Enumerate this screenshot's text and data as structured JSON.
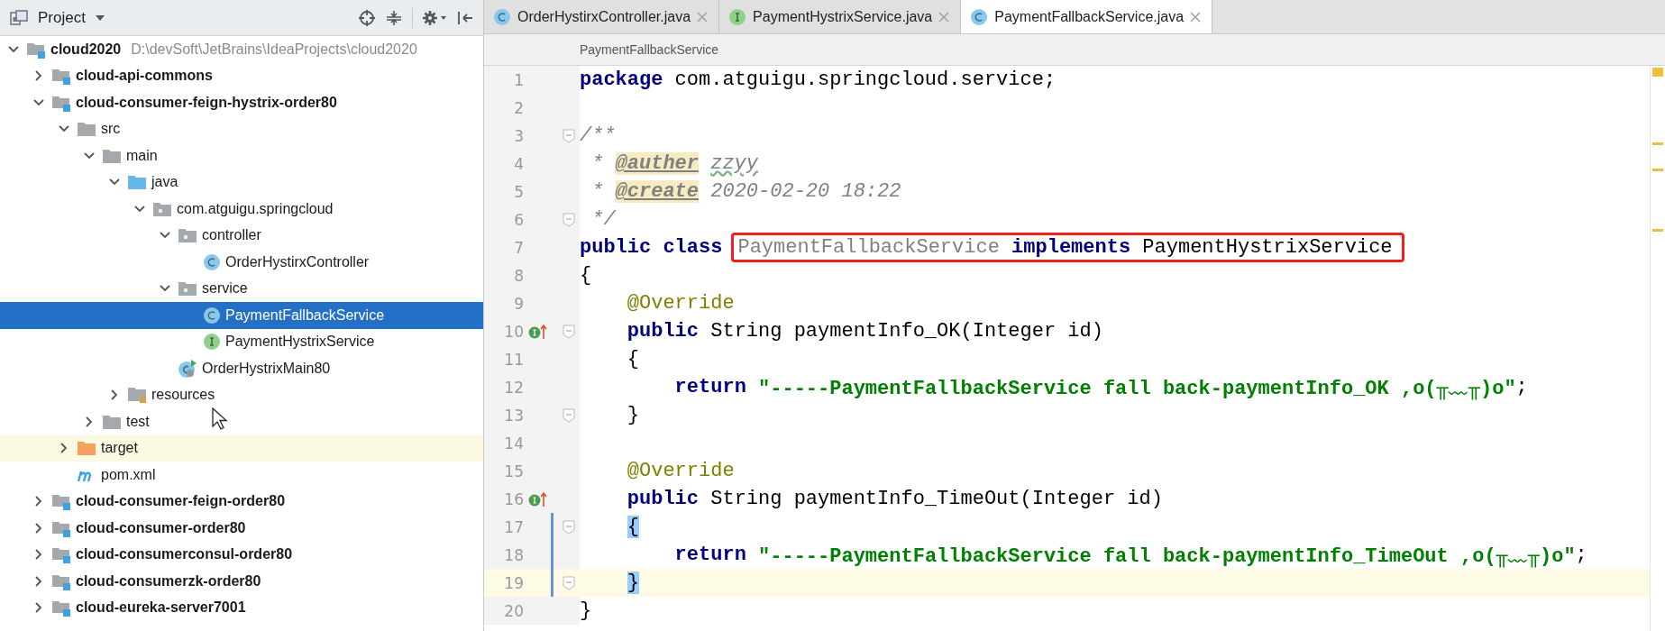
{
  "project_panel": {
    "title": "Project"
  },
  "tree": [
    {
      "label": "cloud2020",
      "detail": "D:\\devSoft\\JetBrains\\IdeaProjects\\cloud2020",
      "kind": "module",
      "expanded": true,
      "selected": false,
      "children": [
        {
          "label": "cloud-api-commons",
          "kind": "module",
          "expanded": false,
          "selected": false
        },
        {
          "label": "cloud-consumer-feign-hystrix-order80",
          "kind": "module",
          "expanded": true,
          "selected": false,
          "children": [
            {
              "label": "src",
              "kind": "folder",
              "expanded": true,
              "selected": false,
              "children": [
                {
                  "label": "main",
                  "kind": "folder",
                  "expanded": true,
                  "selected": false,
                  "children": [
                    {
                      "label": "java",
                      "kind": "source",
                      "expanded": true,
                      "selected": false,
                      "children": [
                        {
                          "label": "com.atguigu.springcloud",
                          "kind": "package",
                          "expanded": true,
                          "selected": false,
                          "children": [
                            {
                              "label": "controller",
                              "kind": "package",
                              "expanded": true,
                              "selected": false,
                              "children": [
                                {
                                  "label": "OrderHystirxController",
                                  "kind": "class",
                                  "selected": false
                                }
                              ]
                            },
                            {
                              "label": "service",
                              "kind": "package",
                              "expanded": true,
                              "selected": false,
                              "children": [
                                {
                                  "label": "PaymentFallbackService",
                                  "kind": "class",
                                  "selected": true
                                },
                                {
                                  "label": "PaymentHystrixService",
                                  "kind": "interface",
                                  "selected": false
                                }
                              ]
                            },
                            {
                              "label": "OrderHystrixMain80",
                              "kind": "app",
                              "selected": false
                            }
                          ]
                        }
                      ]
                    },
                    {
                      "label": "resources",
                      "kind": "resources",
                      "expanded": false,
                      "selected": false
                    }
                  ]
                },
                {
                  "label": "test",
                  "kind": "folder",
                  "expanded": false,
                  "selected": false
                }
              ]
            },
            {
              "label": "target",
              "kind": "excluded",
              "expanded": false,
              "selected": false
            },
            {
              "label": "pom.xml",
              "kind": "maven",
              "selected": false
            }
          ]
        },
        {
          "label": "cloud-consumer-feign-order80",
          "kind": "module",
          "expanded": false,
          "selected": false
        },
        {
          "label": "cloud-consumer-order80",
          "kind": "module",
          "expanded": false,
          "selected": false
        },
        {
          "label": "cloud-consumerconsul-order80",
          "kind": "module",
          "expanded": false,
          "selected": false
        },
        {
          "label": "cloud-consumerzk-order80",
          "kind": "module",
          "expanded": false,
          "selected": false
        },
        {
          "label": "cloud-eureka-server7001",
          "kind": "module",
          "expanded": false,
          "selected": false
        }
      ]
    }
  ],
  "tabs": [
    {
      "label": "OrderHystirxController.java",
      "kind": "class",
      "selected": false
    },
    {
      "label": "PaymentHystrixService.java",
      "kind": "interface",
      "selected": false
    },
    {
      "label": "PaymentFallbackService.java",
      "kind": "class",
      "selected": true
    }
  ],
  "breadcrumb": "PaymentFallbackService",
  "code": [
    {
      "num": "1",
      "fold": false,
      "marker": false,
      "current": false,
      "changed": false,
      "tokens": [
        {
          "text": "package",
          "kind": "keyword"
        },
        {
          "text": " com.atguigu.springcloud.service;",
          "kind": "plain"
        }
      ]
    },
    {
      "num": "2",
      "fold": false,
      "marker": false,
      "current": false,
      "changed": false
    },
    {
      "num": "3",
      "fold": true,
      "marker": false,
      "current": false,
      "changed": false,
      "tokens": [
        {
          "text": "/**",
          "kind": "comment"
        }
      ]
    },
    {
      "num": "4",
      "fold": false,
      "marker": false,
      "current": false,
      "changed": false,
      "tokens": [
        {
          "text": " * ",
          "kind": "comment"
        },
        {
          "text": "@auther",
          "kind": "doctag"
        },
        {
          "text": "zzyy",
          "kind": "typo"
        }
      ]
    },
    {
      "num": "5",
      "fold": false,
      "marker": false,
      "current": false,
      "changed": false,
      "tokens": [
        {
          "text": " * ",
          "kind": "comment"
        },
        {
          "text": "@create",
          "kind": "doctag"
        },
        {
          "text": " 2020-02-20 18:22",
          "kind": "comment"
        }
      ]
    },
    {
      "num": "6",
      "fold": true,
      "marker": false,
      "current": false,
      "changed": false,
      "tokens": [
        {
          "text": " */",
          "kind": "comment"
        }
      ]
    },
    {
      "num": "7",
      "fold": false,
      "marker": false,
      "current": false,
      "changed": false,
      "tokens": [
        {
          "text": "public class",
          "kind": "keyword"
        }
      ],
      "boxed_tokens": [
        {
          "text": "PaymentFallbackService",
          "kind": "unused"
        },
        {
          "text": " implements",
          "kind": "keyword"
        },
        {
          "text": " PaymentHystrixService",
          "kind": "plain"
        }
      ]
    },
    {
      "num": "8",
      "fold": false,
      "marker": false,
      "current": false,
      "changed": false,
      "tokens": [
        {
          "text": "{",
          "kind": "plain"
        }
      ]
    },
    {
      "num": "9",
      "fold": false,
      "marker": false,
      "current": false,
      "changed": false,
      "tokens": [
        {
          "text": "    @Override",
          "kind": "annotation"
        }
      ]
    },
    {
      "num": "10",
      "fold": true,
      "marker": true,
      "current": false,
      "changed": false,
      "tokens": [
        {
          "text": "    public",
          "kind": "keyword"
        },
        {
          "text": " String paymentInfo_OK(Integer id)",
          "kind": "plain"
        }
      ]
    },
    {
      "num": "11",
      "fold": false,
      "marker": false,
      "current": false,
      "changed": false,
      "tokens": [
        {
          "text": "    {",
          "kind": "plain"
        }
      ]
    },
    {
      "num": "12",
      "fold": false,
      "marker": false,
      "current": false,
      "changed": false,
      "tokens": [
        {
          "text": "        return ",
          "kind": "keyword"
        },
        {
          "text": "\"-----PaymentFallbackService fall back-paymentInfo_OK ,o(╥﹏╥)o\"",
          "kind": "string"
        },
        {
          "text": ";",
          "kind": "plain"
        }
      ]
    },
    {
      "num": "13",
      "fold": true,
      "marker": false,
      "current": false,
      "changed": false,
      "tokens": [
        {
          "text": "    }",
          "kind": "plain"
        }
      ]
    },
    {
      "num": "14",
      "fold": false,
      "marker": false,
      "current": false,
      "changed": false
    },
    {
      "num": "15",
      "fold": false,
      "marker": false,
      "current": false,
      "changed": false,
      "tokens": [
        {
          "text": "    @Override",
          "kind": "annotation"
        }
      ]
    },
    {
      "num": "16",
      "fold": false,
      "marker": true,
      "current": false,
      "changed": false,
      "tokens": [
        {
          "text": "    public",
          "kind": "keyword"
        },
        {
          "text": " String paymentInfo_TimeOut(Integer id)",
          "kind": "plain"
        }
      ]
    },
    {
      "num": "17",
      "fold": true,
      "marker": false,
      "current": false,
      "changed": true,
      "tokens": [
        {
          "text": "{",
          "kind": "indented-brace"
        }
      ]
    },
    {
      "num": "18",
      "fold": false,
      "marker": false,
      "current": false,
      "changed": true,
      "tokens": [
        {
          "text": "        return ",
          "kind": "keyword"
        },
        {
          "text": "\"-----PaymentFallbackService fall back-paymentInfo_TimeOut ,o(╥﹏╥)o\"",
          "kind": "string"
        },
        {
          "text": ";",
          "kind": "plain"
        }
      ]
    },
    {
      "num": "19",
      "fold": true,
      "marker": false,
      "current": true,
      "changed": true,
      "tokens": [
        {
          "text": "}",
          "kind": "indented-brace"
        }
      ]
    },
    {
      "num": "20",
      "fold": false,
      "marker": false,
      "current": false,
      "changed": false,
      "tokens": [
        {
          "text": "}",
          "kind": "plain"
        }
      ]
    }
  ]
}
